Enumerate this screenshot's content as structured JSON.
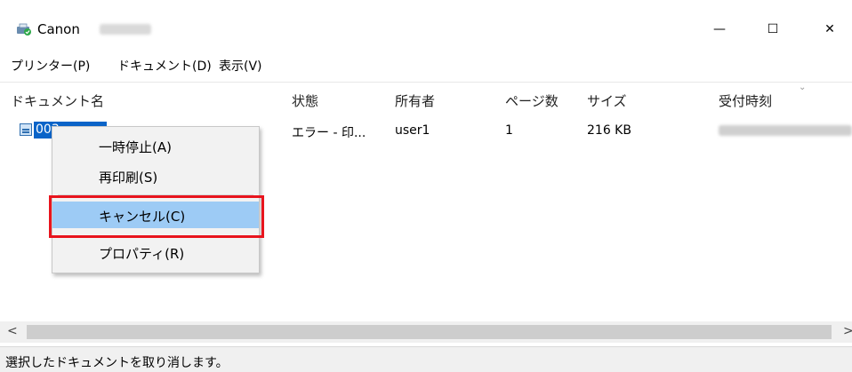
{
  "window": {
    "title": "Canon",
    "controls": {
      "minimize": "—",
      "maximize": "☐",
      "close": "✕"
    }
  },
  "menubar": {
    "items": [
      "プリンター(P)",
      "ドキュメント(D)",
      "表示(V)"
    ]
  },
  "list": {
    "columns": [
      "ドキュメント名",
      "状態",
      "所有者",
      "ページ数",
      "サイズ",
      "受付時刻"
    ],
    "rows": [
      {
        "name": "003",
        "status": "エラー - 印...",
        "owner": "user1",
        "pages": "1",
        "size": "216 KB"
      }
    ]
  },
  "context_menu": {
    "items": [
      "一時停止(A)",
      "再印刷(S)",
      "キャンセル(C)",
      "プロパティ(R)"
    ],
    "highlighted": "キャンセル(C)"
  },
  "scrollbar": {
    "left_arrow": "<",
    "right_arrow": ">"
  },
  "statusbar": {
    "text": "選択したドキュメントを取り消します。"
  },
  "colors": {
    "selection": "#0a64c8",
    "menu_highlight": "#9dcbf5",
    "callout": "#e8141d",
    "menu_bg": "#f2f2f2"
  },
  "icons": [
    "printer-app-icon",
    "document-icon"
  ]
}
